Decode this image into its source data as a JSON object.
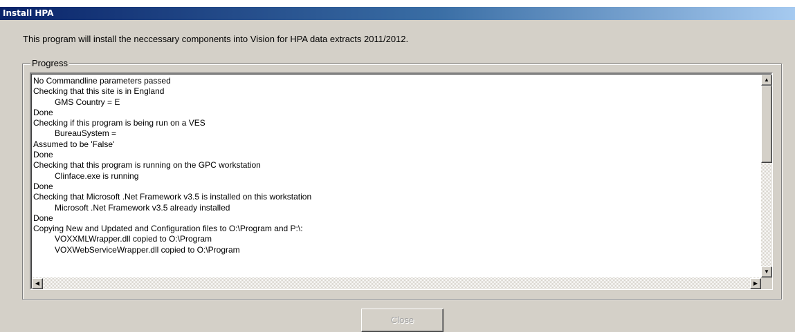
{
  "window": {
    "title": "Install HPA"
  },
  "intro_text": "This program will install the neccessary components into Vision for HPA data extracts 2011/2012.",
  "progress": {
    "group_label": "Progress",
    "lines": [
      {
        "text": "No Commandline parameters passed",
        "indent": false
      },
      {
        "text": "Checking that this site is in England",
        "indent": false
      },
      {
        "text": "GMS Country = E",
        "indent": true
      },
      {
        "text": "Done",
        "indent": false
      },
      {
        "text": "Checking if this program is being run on a VES",
        "indent": false
      },
      {
        "text": "BureauSystem =",
        "indent": true
      },
      {
        "text": "Assumed to be 'False'",
        "indent": false
      },
      {
        "text": "Done",
        "indent": false
      },
      {
        "text": "Checking that this program is running on the GPC workstation",
        "indent": false
      },
      {
        "text": "Clinface.exe is running",
        "indent": true
      },
      {
        "text": "Done",
        "indent": false
      },
      {
        "text": "Checking that Microsoft .Net Framework v3.5 is installed on this workstation",
        "indent": false
      },
      {
        "text": "Microsoft .Net Framework v3.5 already installed",
        "indent": true
      },
      {
        "text": "Done",
        "indent": false
      },
      {
        "text": "Copying New and Updated and Configuration files to O:\\Program and P:\\:",
        "indent": false
      },
      {
        "text": "VOXXMLWrapper.dll copied to O:\\Program",
        "indent": true
      },
      {
        "text": "VOXWebServiceWrapper.dll copied to O:\\Program",
        "indent": true
      }
    ]
  },
  "buttons": {
    "close_label": "Close"
  },
  "colors": {
    "title_start": "#0a246a",
    "title_end": "#a6caf0",
    "face": "#d4d0c8"
  }
}
